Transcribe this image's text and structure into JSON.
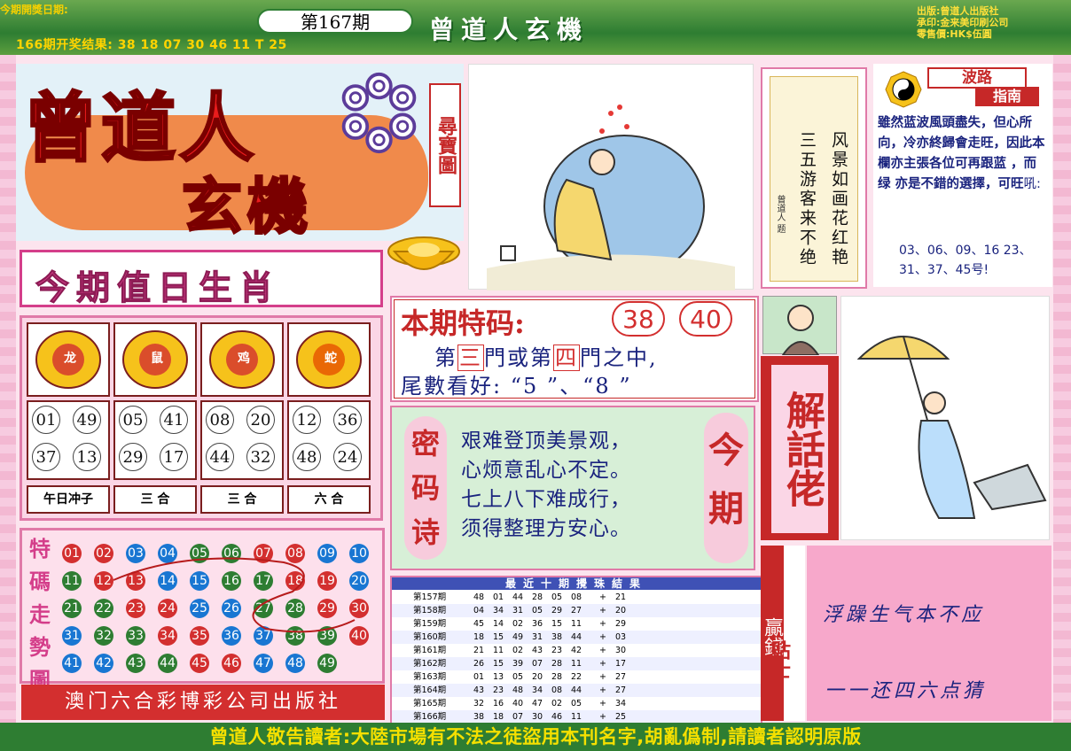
{
  "header": {
    "issue_label": "今期開獎日期:",
    "prev_result": "166期开奖结果: 38 18 07 30 46 11 T 25",
    "issue": "第167期",
    "title": "曾道人玄機",
    "publisher_lines": [
      "出版:曾道人出版社",
      "承印:金来美印刷公司",
      "零售價:HK$伍圓"
    ]
  },
  "logo": {
    "line1": "曾道人",
    "line2": "玄機",
    "treasure_map": "尋寶圖"
  },
  "poem": {
    "col1": "风景如画花红艳",
    "col2": "三五游客来不绝",
    "signature": "曾道人 题"
  },
  "guide": {
    "tag1": "波路",
    "tag2": "指南",
    "text": "雖然蓝波風頭盡失，但心所向，冷亦終歸會走旺，因此本欄亦主張各位可再跟蓝 ，而 绿 亦是不錯的選擇，可旺",
    "nums_prefix": "吼:",
    "nums": "03、06、09、16 23、31、37、45号!"
  },
  "zodiac": {
    "title": "今期值日生肖",
    "animals": [
      {
        "name": "龙",
        "nums": [
          "01",
          "49",
          "37",
          "13"
        ],
        "label": "午日冲子"
      },
      {
        "name": "鼠",
        "nums": [
          "05",
          "41",
          "29",
          "17"
        ],
        "label": "三  合"
      },
      {
        "name": "鸡",
        "nums": [
          "08",
          "20",
          "44",
          "32"
        ],
        "label": "三  合"
      },
      {
        "name": "蛇",
        "nums": [
          "12",
          "36",
          "48",
          "24"
        ],
        "label": "六  合"
      }
    ]
  },
  "trend": {
    "title": "特碼走勢圖",
    "balls": [
      [
        "01",
        "r"
      ],
      [
        "02",
        "r"
      ],
      [
        "03",
        "b"
      ],
      [
        "04",
        "b"
      ],
      [
        "05",
        "g"
      ],
      [
        "06",
        "g"
      ],
      [
        "07",
        "r"
      ],
      [
        "08",
        "r"
      ],
      [
        "09",
        "b"
      ],
      [
        "10",
        "b"
      ],
      [
        "11",
        "g"
      ],
      [
        "12",
        "r"
      ],
      [
        "13",
        "r"
      ],
      [
        "14",
        "b"
      ],
      [
        "15",
        "b"
      ],
      [
        "16",
        "g"
      ],
      [
        "17",
        "g"
      ],
      [
        "18",
        "r"
      ],
      [
        "19",
        "r"
      ],
      [
        "20",
        "b"
      ],
      [
        "21",
        "g"
      ],
      [
        "22",
        "g"
      ],
      [
        "23",
        "r"
      ],
      [
        "24",
        "r"
      ],
      [
        "25",
        "b"
      ],
      [
        "26",
        "b"
      ],
      [
        "27",
        "g"
      ],
      [
        "28",
        "g"
      ],
      [
        "29",
        "r"
      ],
      [
        "30",
        "r"
      ],
      [
        "31",
        "b"
      ],
      [
        "32",
        "g"
      ],
      [
        "33",
        "g"
      ],
      [
        "34",
        "r"
      ],
      [
        "35",
        "r"
      ],
      [
        "36",
        "b"
      ],
      [
        "37",
        "b"
      ],
      [
        "38",
        "g"
      ],
      [
        "39",
        "g"
      ],
      [
        "40",
        "r"
      ],
      [
        "41",
        "b"
      ],
      [
        "42",
        "b"
      ],
      [
        "43",
        "g"
      ],
      [
        "44",
        "g"
      ],
      [
        "45",
        "r"
      ],
      [
        "46",
        "r"
      ],
      [
        "47",
        "b"
      ],
      [
        "48",
        "b"
      ],
      [
        "49",
        "g"
      ]
    ]
  },
  "publisher": "澳门六合彩博彩公司出版社",
  "special": {
    "label": "本期特码:",
    "num1": "38",
    "num2": "40",
    "line1_a": "第",
    "line1_b": "三",
    "line1_c": "門或第",
    "line1_d": "四",
    "line1_e": "門之中,",
    "line2": "尾數看好: “5 ”、“8 ”"
  },
  "password": {
    "tag_left": "密码诗",
    "tag_right": "今期",
    "lines": [
      "艰难登顶美景观，",
      "心烦意乱心不定。",
      "七上八下难成行，",
      "须得整理方安心。"
    ]
  },
  "history": {
    "title": "最近十期攪珠結果",
    "rows": [
      {
        "issue": "第157期",
        "nums": [
          "48",
          "01",
          "44",
          "28",
          "05",
          "08"
        ],
        "plus": "+",
        "sp": "21"
      },
      {
        "issue": "第158期",
        "nums": [
          "04",
          "34",
          "31",
          "05",
          "29",
          "27"
        ],
        "plus": "+",
        "sp": "20"
      },
      {
        "issue": "第159期",
        "nums": [
          "45",
          "14",
          "02",
          "36",
          "15",
          "11"
        ],
        "plus": "+",
        "sp": "29"
      },
      {
        "issue": "第160期",
        "nums": [
          "18",
          "15",
          "49",
          "31",
          "38",
          "44"
        ],
        "plus": "+",
        "sp": "03"
      },
      {
        "issue": "第161期",
        "nums": [
          "21",
          "11",
          "02",
          "43",
          "23",
          "42"
        ],
        "plus": "+",
        "sp": "30"
      },
      {
        "issue": "第162期",
        "nums": [
          "26",
          "15",
          "39",
          "07",
          "28",
          "11"
        ],
        "plus": "+",
        "sp": "17"
      },
      {
        "issue": "第163期",
        "nums": [
          "01",
          "13",
          "05",
          "20",
          "28",
          "22"
        ],
        "plus": "+",
        "sp": "27"
      },
      {
        "issue": "第164期",
        "nums": [
          "43",
          "23",
          "48",
          "34",
          "08",
          "44"
        ],
        "plus": "+",
        "sp": "27"
      },
      {
        "issue": "第165期",
        "nums": [
          "32",
          "16",
          "40",
          "47",
          "02",
          "05"
        ],
        "plus": "+",
        "sp": "34"
      },
      {
        "issue": "第166期",
        "nums": [
          "38",
          "18",
          "07",
          "30",
          "46",
          "11"
        ],
        "plus": "+",
        "sp": "25"
      }
    ]
  },
  "explain": "解話佬",
  "tips": {
    "left": "贏錢",
    "right": "貼士",
    "line1": "浮躁生气本不应",
    "line2": "一一还四六点猜"
  },
  "footer": "曾道人敬告讀者:大陸市場有不法之徒盜用本刊名字,胡亂僞制,請讀者認明原版"
}
